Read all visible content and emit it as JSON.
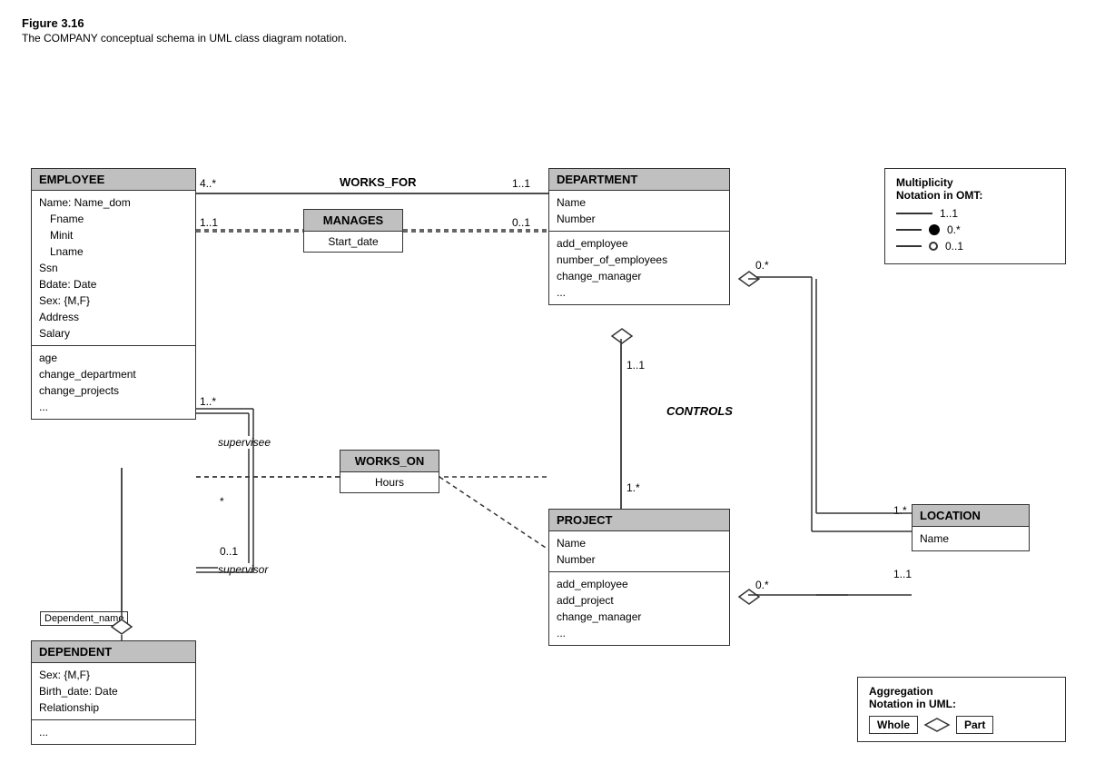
{
  "figure": {
    "title": "Figure 3.16",
    "caption": "The COMPANY conceptual schema in UML class diagram notation."
  },
  "classes": {
    "employee": {
      "header": "EMPLOYEE",
      "section1": [
        "Name: Name_dom",
        "  Fname",
        "  Minit",
        "  Lname",
        "Ssn",
        "Bdate: Date",
        "Sex: {M,F}",
        "Address",
        "Salary"
      ],
      "section2": [
        "age",
        "change_department",
        "change_projects",
        "..."
      ]
    },
    "dependent": {
      "header": "DEPENDENT",
      "section1": [
        "Sex: {M,F}",
        "Birth_date: Date",
        "Relationship"
      ],
      "section2": [
        "..."
      ]
    },
    "department": {
      "header": "DEPARTMENT",
      "section1": [
        "Name",
        "Number"
      ],
      "section2": [
        "add_employee",
        "number_of_employees",
        "change_manager",
        "..."
      ]
    },
    "project": {
      "header": "PROJECT",
      "section1": [
        "Name",
        "Number"
      ],
      "section2": [
        "add_employee",
        "add_project",
        "change_manager",
        "..."
      ]
    },
    "location": {
      "header": "LOCATION",
      "section1": [
        "Name"
      ]
    }
  },
  "assoc": {
    "manages": {
      "header": "MANAGES",
      "section": "Start_date"
    },
    "works_on": {
      "header": "WORKS_ON",
      "section": "Hours"
    }
  },
  "relationships": {
    "works_for": "WORKS_FOR",
    "controls": "CONTROLS",
    "supervisee": "supervisee",
    "supervisor": "supervisor",
    "dependent_name": "Dependent_name"
  },
  "multiplicities": {
    "works_for_emp": "4..*",
    "works_for_dep": "1..1",
    "manages_emp": "1..1",
    "manages_dep": "0..1",
    "supervises_many": "1..*",
    "supervises_star": "*",
    "supervises_zero": "0..1",
    "dep_controls_proj": "1..1",
    "dep_star": "0.*",
    "proj_star": "1.*",
    "proj_loc_star": "0.*",
    "loc_proj": "1.*",
    "loc_dep": "1..1"
  },
  "notation": {
    "title1": "Multiplicity",
    "title2": "Notation in OMT:",
    "rows": [
      {
        "line": true,
        "label": "1..1"
      },
      {
        "dot": true,
        "label": "0.*"
      },
      {
        "circle": true,
        "label": "0..1"
      }
    ]
  },
  "aggregation": {
    "title1": "Aggregation",
    "title2": "Notation in UML:",
    "whole_label": "Whole",
    "part_label": "Part"
  }
}
